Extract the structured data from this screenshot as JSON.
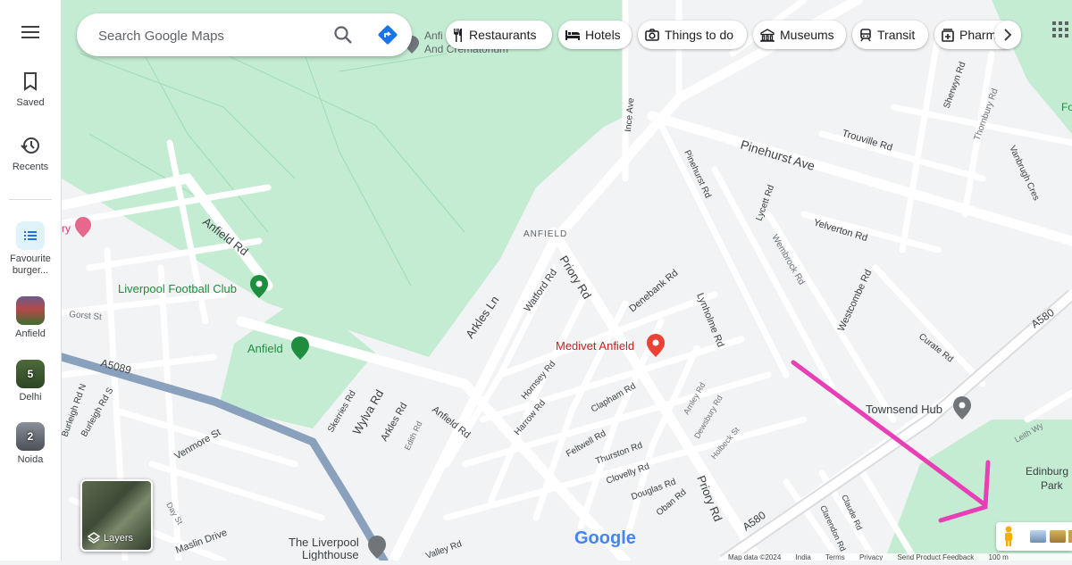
{
  "sidebar": {
    "menu_icon": "hamburger-menu-icon",
    "items": [
      {
        "label": "Saved",
        "icon": "bookmark-icon"
      },
      {
        "label": "Recents",
        "icon": "history-icon"
      }
    ],
    "lists": [
      {
        "label": "Favourite burger...",
        "icon": "list-icon"
      },
      {
        "label": "Anfield"
      },
      {
        "label": "Delhi",
        "badge": "5"
      },
      {
        "label": "Noida",
        "badge": "2"
      }
    ]
  },
  "search": {
    "placeholder": "Search Google Maps"
  },
  "chips": [
    {
      "label": "Restaurants",
      "icon": "fork-knife-icon"
    },
    {
      "label": "Hotels",
      "icon": "bed-icon"
    },
    {
      "label": "Things to do",
      "icon": "camera-icon"
    },
    {
      "label": "Museums",
      "icon": "museum-icon"
    },
    {
      "label": "Transit",
      "icon": "train-icon"
    },
    {
      "label": "Pharmacies",
      "icon": "pharmacy-icon"
    }
  ],
  "layers": {
    "label": "Layers"
  },
  "map": {
    "places": {
      "lfc": "Liverpool Football Club",
      "anfield_stadium": "Anfield",
      "medivet": "Medivet Anfield",
      "townsend": "Townsend Hub",
      "edinburgh_1": "Edinburg",
      "edinburgh_2": "Park",
      "lighthouse_1": "The Liverpool",
      "lighthouse_2": "Lighthouse",
      "crem_1": "Anfi",
      "crem_2": "And Crematorium",
      "hotel_partial": "ry",
      "park_f": "Fo"
    },
    "areas": {
      "anfield": "ANFIELD"
    },
    "roads": {
      "pinehurst_ave": "Pinehurst Ave",
      "yelverton": "Yelverton Rd",
      "trouville": "Trouville Rd",
      "anfield_rd": "Anfield Rd",
      "anfield_rd2": "Anfield Rd",
      "priory_rd": "Priory Rd",
      "priory_rd2": "Priory Rd",
      "arkles_ln": "Arkles Ln",
      "arkles_rd": "Arkles Rd",
      "watford": "Watford Rd",
      "denebank": "Denebank Rd",
      "lynholme": "Lynholme Rd",
      "a5089": "A5089",
      "a580": "A580",
      "a580b": "A580",
      "ince": "Ince Ave",
      "pinehurst_rd": "Pinehurst Rd",
      "lycett": "Lycett Rd",
      "wembrock": "Wembrock Rd",
      "westcombe": "Westcombe Rd",
      "curate": "Curate Rd",
      "sherwyn": "Sherwyn Rd",
      "thornbury": "Thornbury Rd",
      "vanbrugh": "Vanbrugh Cres",
      "gorst": "Gorst St",
      "venmore": "Venmore St",
      "skerries": "Skerries Rd",
      "wylva": "Wylva Rd",
      "hornsey": "Hornsey Rd",
      "harrow": "Harrow Rd",
      "clapham": "Clapham Rd",
      "feltwell": "Feltwell Rd",
      "thurston": "Thurston Rd",
      "clovelly": "Clovelly Rd",
      "douglas": "Douglas Rd",
      "oban": "Oban Rd",
      "arnley": "Arnley Rd",
      "dewsbury": "Dewsbury Rd",
      "holbeck": "Holbeck St",
      "edith": "Edith Rd",
      "burleigh_n": "Burleigh Rd N",
      "burleigh_s": "Burleigh Rd S",
      "day": "Day St",
      "maslin": "Maslin Drive",
      "claude": "Claude Rd",
      "clarendon": "Clarendon Rd",
      "leith": "Leith Wy",
      "valley": "Valley Rd"
    }
  },
  "branding": {
    "logo": "Google"
  },
  "footer": {
    "map_data": "Map data ©2024",
    "country": "India",
    "terms": "Terms",
    "privacy": "Privacy",
    "feedback": "Send Product Feedback",
    "scale": "100 m"
  },
  "annotation": {
    "arrow_color": "#e83fb6"
  },
  "colors": {
    "park": "#c3ecd2",
    "road": "#ffffff",
    "land": "#f1f3f4",
    "major_road": "#8aa1bd",
    "place_green": "#1e8e3e",
    "place_red": "#c5221f",
    "accent_blue": "#1a73e8"
  }
}
